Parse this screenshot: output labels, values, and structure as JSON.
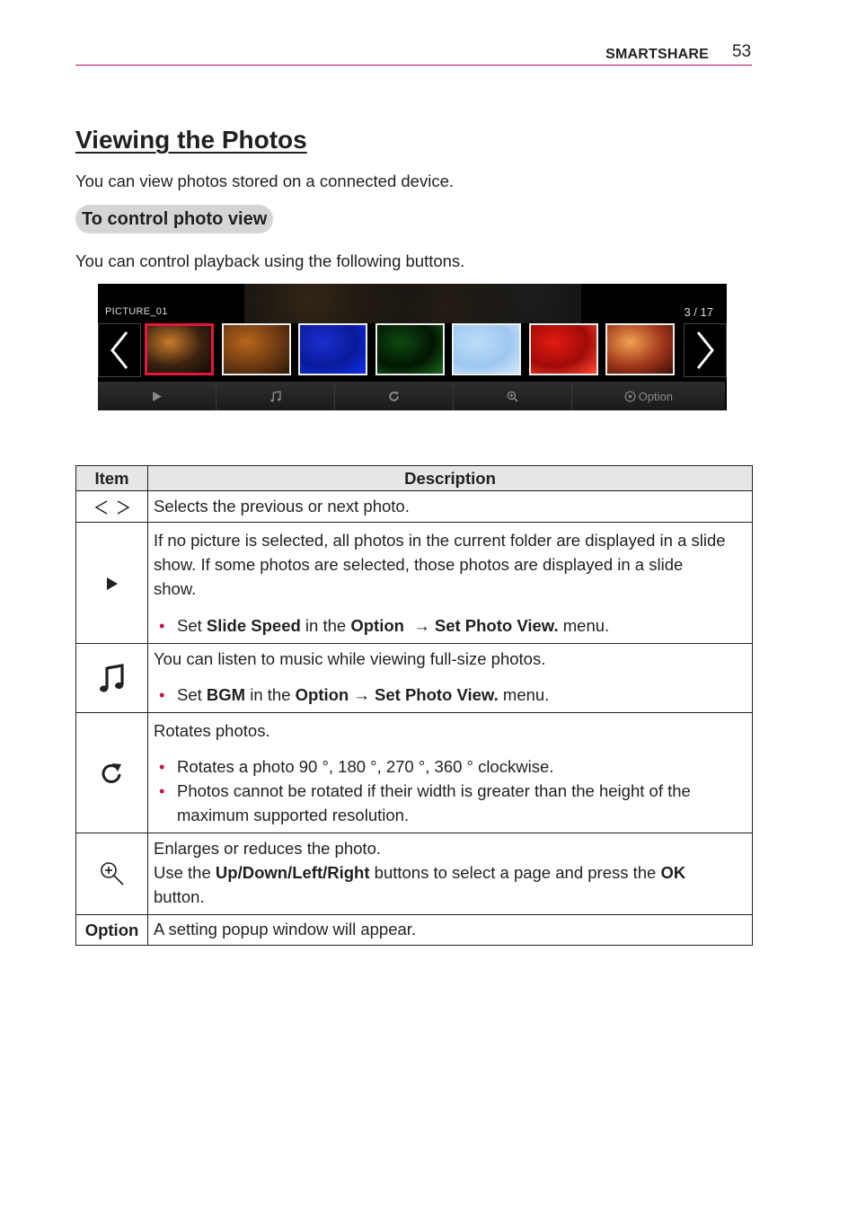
{
  "header": {
    "section": "SMARTSHARE",
    "page_number": "53"
  },
  "title": "Viewing the Photos",
  "intro": "You can view photos stored on a connected device.",
  "subheading": "To control photo view",
  "subintro": "You can control playback using the following buttons.",
  "tv_ui": {
    "picture_name": "PICTURE_01",
    "counter": "3 / 17",
    "selected_index": 0,
    "thumbnails": [
      {
        "name": "rock-cliff-sunset",
        "colors": [
          "#c77a2a",
          "#3a2210",
          "#120a05"
        ]
      },
      {
        "name": "golden-rock",
        "colors": [
          "#b8661c",
          "#6d3a12",
          "#2a1707"
        ]
      },
      {
        "name": "blue-abstract",
        "colors": [
          "#1a2fd0",
          "#0a1a9a",
          "#0e2ef0"
        ]
      },
      {
        "name": "green-abstract",
        "colors": [
          "#0d4a0f",
          "#021602",
          "#1b6a1e"
        ]
      },
      {
        "name": "light-blue-sky",
        "colors": [
          "#bcdcf6",
          "#9ec8f0",
          "#d3e8fa"
        ]
      },
      {
        "name": "red-flower",
        "colors": [
          "#e21a10",
          "#a00b08",
          "#ff4a30"
        ]
      },
      {
        "name": "orange-closeup",
        "colors": [
          "#f0a050",
          "#a0361a",
          "#3a0e05"
        ]
      }
    ],
    "toolbar": [
      {
        "icon": "play-icon",
        "label": ""
      },
      {
        "icon": "music-note-icon",
        "label": ""
      },
      {
        "icon": "rotate-icon",
        "label": ""
      },
      {
        "icon": "zoom-in-icon",
        "label": ""
      },
      {
        "icon": "gear-icon",
        "label": "Option"
      }
    ]
  },
  "table": {
    "headers": [
      "Item",
      "Description"
    ],
    "rows": [
      {
        "item_icon": "prev-next-icon",
        "item_text": "< >",
        "desc": "Selects the previous or next photo."
      },
      {
        "item_icon": "play-icon",
        "desc": "If no picture is selected, all photos in the current folder are displayed in a slide show. If some photos are selected, those photos are displayed in a slide show.",
        "bullets": [
          {
            "pre": "Set ",
            "b1": "Slide Speed",
            "mid": " in the ",
            "b2": "Option",
            "arrow": "  → ",
            "b3": "Set Photo View.",
            "post": " menu."
          }
        ]
      },
      {
        "item_icon": "music-note-icon",
        "desc": "You can listen to music while viewing full-size photos.",
        "bullets": [
          {
            "pre": "Set ",
            "b1": "BGM",
            "mid": " in the ",
            "b2": "Option",
            "arrow": " → ",
            "b3": "Set Photo View.",
            "post": " menu."
          }
        ]
      },
      {
        "item_icon": "rotate-icon",
        "desc": "Rotates photos.",
        "bullets": [
          "Rotates a photo 90 °, 180 °, 270 °, 360 ° clockwise.",
          "Photos cannot be rotated if their width is greater than the height of the maximum supported resolution."
        ]
      },
      {
        "item_icon": "zoom-in-icon",
        "desc_line1": "Enlarges or reduces the photo.",
        "desc_line2_pre": "Use the ",
        "desc_line2_b1": "Up/Down/Left/Right",
        "desc_line2_mid": " buttons to select a page and press the ",
        "desc_line2_b2": "OK",
        "desc_line2_post": " button."
      },
      {
        "item_text": "Option",
        "desc": "A setting popup window will appear."
      }
    ]
  },
  "colors": {
    "accent_rule": "#b5125e",
    "bullet": "#c4145b",
    "selection": "#e4173e",
    "pill_bg": "#d5d5d5",
    "header_bg": "#e6e6e6"
  }
}
